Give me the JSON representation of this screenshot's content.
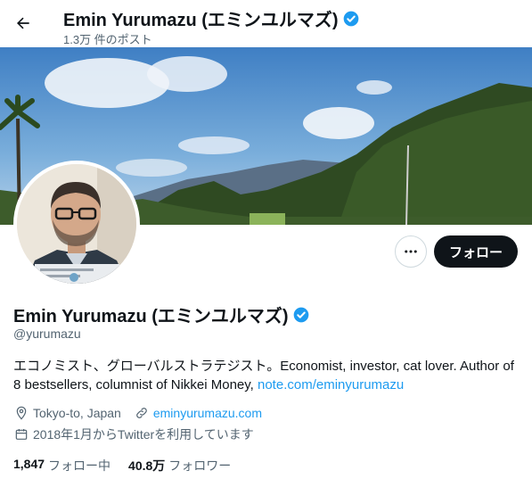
{
  "header": {
    "title": "Emin Yurumazu (エミンユルマズ)",
    "post_count": "1.3万 件のポスト"
  },
  "profile": {
    "display_name": "Emin Yurumazu (エミンユルマズ)",
    "handle": "@yurumazu",
    "bio_text": "エコノミスト、グローバルストラテジスト。Economist, investor, cat lover. Author of 8 bestsellers, columnist of Nikkei Money, ",
    "bio_link": "note.com/eminyurumazu",
    "location": "Tokyo-to, Japan",
    "website": "eminyurumazu.com",
    "joined": "2018年1月からTwitterを利用しています"
  },
  "actions": {
    "follow_label": "フォロー"
  },
  "stats": {
    "following_count": "1,847",
    "following_label": "フォロー中",
    "followers_count": "40.8万",
    "followers_label": "フォロワー"
  },
  "colors": {
    "accent": "#1d9bf0",
    "text": "#0f1419",
    "secondary": "#536471",
    "button_dark": "#0f1419"
  },
  "icons": [
    "back-arrow-icon",
    "verified-badge-icon",
    "more-dots-icon",
    "location-pin-icon",
    "link-icon",
    "calendar-icon"
  ]
}
